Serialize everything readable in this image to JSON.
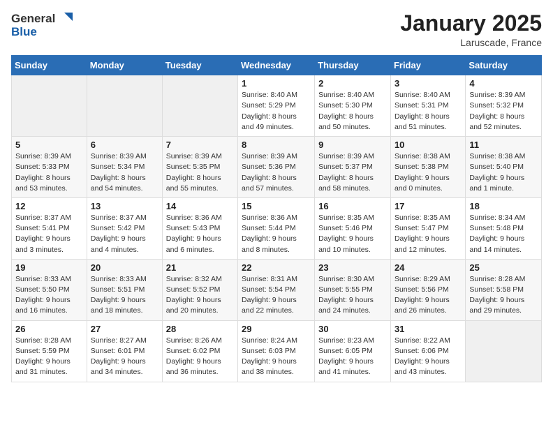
{
  "header": {
    "logo_general": "General",
    "logo_blue": "Blue",
    "month_title": "January 2025",
    "location": "Laruscade, France"
  },
  "weekdays": [
    "Sunday",
    "Monday",
    "Tuesday",
    "Wednesday",
    "Thursday",
    "Friday",
    "Saturday"
  ],
  "weeks": [
    [
      {
        "day": "",
        "info": ""
      },
      {
        "day": "",
        "info": ""
      },
      {
        "day": "",
        "info": ""
      },
      {
        "day": "1",
        "info": "Sunrise: 8:40 AM\nSunset: 5:29 PM\nDaylight: 8 hours\nand 49 minutes."
      },
      {
        "day": "2",
        "info": "Sunrise: 8:40 AM\nSunset: 5:30 PM\nDaylight: 8 hours\nand 50 minutes."
      },
      {
        "day": "3",
        "info": "Sunrise: 8:40 AM\nSunset: 5:31 PM\nDaylight: 8 hours\nand 51 minutes."
      },
      {
        "day": "4",
        "info": "Sunrise: 8:39 AM\nSunset: 5:32 PM\nDaylight: 8 hours\nand 52 minutes."
      }
    ],
    [
      {
        "day": "5",
        "info": "Sunrise: 8:39 AM\nSunset: 5:33 PM\nDaylight: 8 hours\nand 53 minutes."
      },
      {
        "day": "6",
        "info": "Sunrise: 8:39 AM\nSunset: 5:34 PM\nDaylight: 8 hours\nand 54 minutes."
      },
      {
        "day": "7",
        "info": "Sunrise: 8:39 AM\nSunset: 5:35 PM\nDaylight: 8 hours\nand 55 minutes."
      },
      {
        "day": "8",
        "info": "Sunrise: 8:39 AM\nSunset: 5:36 PM\nDaylight: 8 hours\nand 57 minutes."
      },
      {
        "day": "9",
        "info": "Sunrise: 8:39 AM\nSunset: 5:37 PM\nDaylight: 8 hours\nand 58 minutes."
      },
      {
        "day": "10",
        "info": "Sunrise: 8:38 AM\nSunset: 5:38 PM\nDaylight: 9 hours\nand 0 minutes."
      },
      {
        "day": "11",
        "info": "Sunrise: 8:38 AM\nSunset: 5:40 PM\nDaylight: 9 hours\nand 1 minute."
      }
    ],
    [
      {
        "day": "12",
        "info": "Sunrise: 8:37 AM\nSunset: 5:41 PM\nDaylight: 9 hours\nand 3 minutes."
      },
      {
        "day": "13",
        "info": "Sunrise: 8:37 AM\nSunset: 5:42 PM\nDaylight: 9 hours\nand 4 minutes."
      },
      {
        "day": "14",
        "info": "Sunrise: 8:36 AM\nSunset: 5:43 PM\nDaylight: 9 hours\nand 6 minutes."
      },
      {
        "day": "15",
        "info": "Sunrise: 8:36 AM\nSunset: 5:44 PM\nDaylight: 9 hours\nand 8 minutes."
      },
      {
        "day": "16",
        "info": "Sunrise: 8:35 AM\nSunset: 5:46 PM\nDaylight: 9 hours\nand 10 minutes."
      },
      {
        "day": "17",
        "info": "Sunrise: 8:35 AM\nSunset: 5:47 PM\nDaylight: 9 hours\nand 12 minutes."
      },
      {
        "day": "18",
        "info": "Sunrise: 8:34 AM\nSunset: 5:48 PM\nDaylight: 9 hours\nand 14 minutes."
      }
    ],
    [
      {
        "day": "19",
        "info": "Sunrise: 8:33 AM\nSunset: 5:50 PM\nDaylight: 9 hours\nand 16 minutes."
      },
      {
        "day": "20",
        "info": "Sunrise: 8:33 AM\nSunset: 5:51 PM\nDaylight: 9 hours\nand 18 minutes."
      },
      {
        "day": "21",
        "info": "Sunrise: 8:32 AM\nSunset: 5:52 PM\nDaylight: 9 hours\nand 20 minutes."
      },
      {
        "day": "22",
        "info": "Sunrise: 8:31 AM\nSunset: 5:54 PM\nDaylight: 9 hours\nand 22 minutes."
      },
      {
        "day": "23",
        "info": "Sunrise: 8:30 AM\nSunset: 5:55 PM\nDaylight: 9 hours\nand 24 minutes."
      },
      {
        "day": "24",
        "info": "Sunrise: 8:29 AM\nSunset: 5:56 PM\nDaylight: 9 hours\nand 26 minutes."
      },
      {
        "day": "25",
        "info": "Sunrise: 8:28 AM\nSunset: 5:58 PM\nDaylight: 9 hours\nand 29 minutes."
      }
    ],
    [
      {
        "day": "26",
        "info": "Sunrise: 8:28 AM\nSunset: 5:59 PM\nDaylight: 9 hours\nand 31 minutes."
      },
      {
        "day": "27",
        "info": "Sunrise: 8:27 AM\nSunset: 6:01 PM\nDaylight: 9 hours\nand 34 minutes."
      },
      {
        "day": "28",
        "info": "Sunrise: 8:26 AM\nSunset: 6:02 PM\nDaylight: 9 hours\nand 36 minutes."
      },
      {
        "day": "29",
        "info": "Sunrise: 8:24 AM\nSunset: 6:03 PM\nDaylight: 9 hours\nand 38 minutes."
      },
      {
        "day": "30",
        "info": "Sunrise: 8:23 AM\nSunset: 6:05 PM\nDaylight: 9 hours\nand 41 minutes."
      },
      {
        "day": "31",
        "info": "Sunrise: 8:22 AM\nSunset: 6:06 PM\nDaylight: 9 hours\nand 43 minutes."
      },
      {
        "day": "",
        "info": ""
      }
    ]
  ]
}
